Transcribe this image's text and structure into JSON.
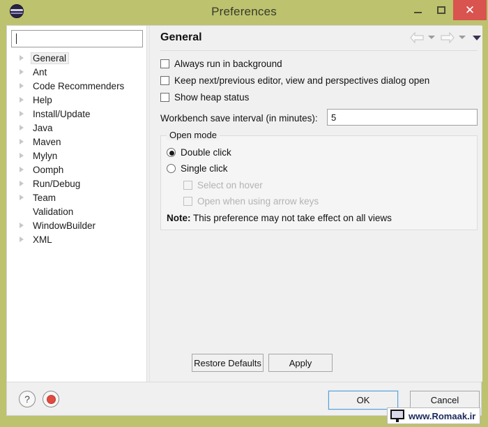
{
  "window": {
    "title": "Preferences",
    "app_icon": "eclipse-icon",
    "controls": {
      "minimize": "minimize-icon",
      "maximize": "maximize-icon",
      "close": "close-icon"
    },
    "colors": {
      "titlebar": "#bcc26e",
      "close_button": "#d9534f",
      "dialog_background": "#f0f0f0",
      "focus_border": "#5a9fd4"
    }
  },
  "sidebar": {
    "filter": {
      "value": "",
      "placeholder": ""
    },
    "items": [
      {
        "label": "General",
        "expandable": true,
        "selected": true
      },
      {
        "label": "Ant",
        "expandable": true,
        "selected": false
      },
      {
        "label": "Code Recommenders",
        "expandable": true,
        "selected": false
      },
      {
        "label": "Help",
        "expandable": true,
        "selected": false
      },
      {
        "label": "Install/Update",
        "expandable": true,
        "selected": false
      },
      {
        "label": "Java",
        "expandable": true,
        "selected": false
      },
      {
        "label": "Maven",
        "expandable": true,
        "selected": false
      },
      {
        "label": "Mylyn",
        "expandable": true,
        "selected": false
      },
      {
        "label": "Oomph",
        "expandable": true,
        "selected": false
      },
      {
        "label": "Run/Debug",
        "expandable": true,
        "selected": false
      },
      {
        "label": "Team",
        "expandable": true,
        "selected": false
      },
      {
        "label": "Validation",
        "expandable": false,
        "selected": false
      },
      {
        "label": "WindowBuilder",
        "expandable": true,
        "selected": false
      },
      {
        "label": "XML",
        "expandable": true,
        "selected": false
      }
    ]
  },
  "page": {
    "title": "General",
    "nav": {
      "back": "arrow-left-icon",
      "back_menu": "chevron-down-icon",
      "forward": "arrow-right-icon",
      "forward_menu": "chevron-down-icon",
      "menu": "chevron-down-icon"
    },
    "checkboxes": [
      {
        "label": "Always run in background",
        "checked": false,
        "enabled": true
      },
      {
        "label": "Keep next/previous editor, view and perspectives dialog open",
        "checked": false,
        "enabled": true
      },
      {
        "label": "Show heap status",
        "checked": false,
        "enabled": true
      }
    ],
    "save_interval": {
      "label": "Workbench save interval (in minutes):",
      "value": "5"
    },
    "open_mode": {
      "legend": "Open mode",
      "radios": [
        {
          "label": "Double click",
          "selected": true
        },
        {
          "label": "Single click",
          "selected": false
        }
      ],
      "sub_checkboxes": [
        {
          "label": "Select on hover",
          "checked": false,
          "enabled": false
        },
        {
          "label": "Open when using arrow keys",
          "checked": false,
          "enabled": false
        }
      ],
      "note_label": "Note:",
      "note_text": "This preference may not take effect on all views"
    },
    "buttons": {
      "restore_defaults": "Restore Defaults",
      "apply": "Apply"
    }
  },
  "footer": {
    "help_icon": "help-icon",
    "help_glyph": "?",
    "record_icon": "record-icon",
    "ok": "OK",
    "cancel": "Cancel"
  },
  "watermark": {
    "icon": "monitor-icon",
    "text": "www.Romaak.ir"
  }
}
